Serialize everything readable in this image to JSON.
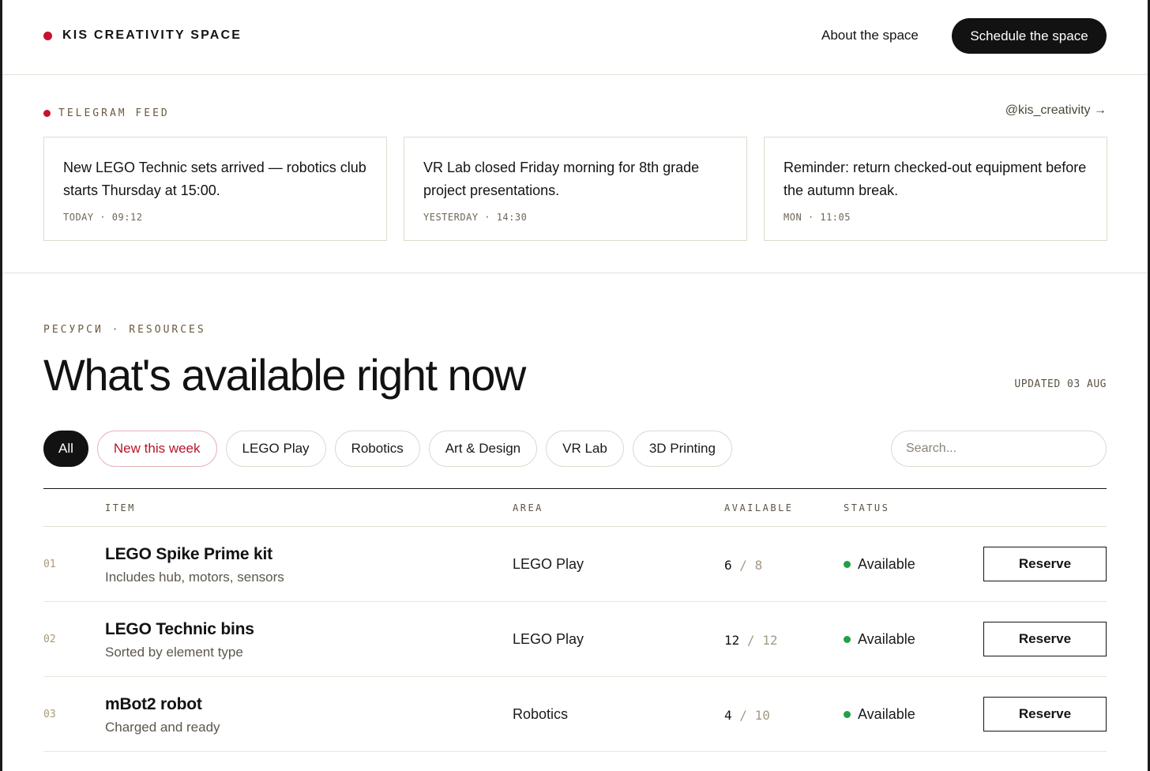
{
  "header": {
    "brand": "KIS CREATIVITY SPACE",
    "nav_link": "About the space",
    "cta": "Schedule the space"
  },
  "feed": {
    "title": "TELEGRAM FEED",
    "handle": "@kis_creativity →",
    "posts": [
      {
        "text": "New LEGO Technic sets arrived — robotics club starts Thursday at 15:00.",
        "time": "TODAY · 09:12"
      },
      {
        "text": "VR Lab closed Friday morning for 8th grade project presentations.",
        "time": "YESTERDAY · 14:30"
      },
      {
        "text": "Reminder: return checked-out equipment before the autumn break.",
        "time": "MON · 11:05"
      }
    ]
  },
  "resources": {
    "eyebrow": "РЕСУРСИ · RESOURCES",
    "title": "What's available right now",
    "updated": "UPDATED 03 AUG",
    "filters": [
      "All",
      "New this week",
      "LEGO Play",
      "Robotics",
      "Art & Design",
      "VR Lab",
      "3D Printing"
    ],
    "search_placeholder": "Search..."
  },
  "table": {
    "headers": {
      "item": "ITEM",
      "area": "AREA",
      "available": "AVAILABLE",
      "status": "STATUS"
    },
    "rows": [
      {
        "num": "01",
        "name": "LEGO Spike Prime kit",
        "sub": "Includes hub, motors, sensors",
        "area": "LEGO Play",
        "avail": "6",
        "sep": "/",
        "total": "8",
        "status": "Available",
        "action": "Reserve"
      },
      {
        "num": "02",
        "name": "LEGO Technic bins",
        "sub": "Sorted by element type",
        "area": "LEGO Play",
        "avail": "12",
        "sep": "/",
        "total": "12",
        "status": "Available",
        "action": "Reserve"
      },
      {
        "num": "03",
        "name": "mBot2 robot",
        "sub": "Charged and ready",
        "area": "Robotics",
        "avail": "4",
        "sep": "/",
        "total": "10",
        "status": "Available",
        "action": "Reserve"
      }
    ]
  },
  "colors": {
    "accent": "#c8102e",
    "ink": "#121212",
    "status_ok": "#22a045",
    "muted": "#6b5a40"
  }
}
